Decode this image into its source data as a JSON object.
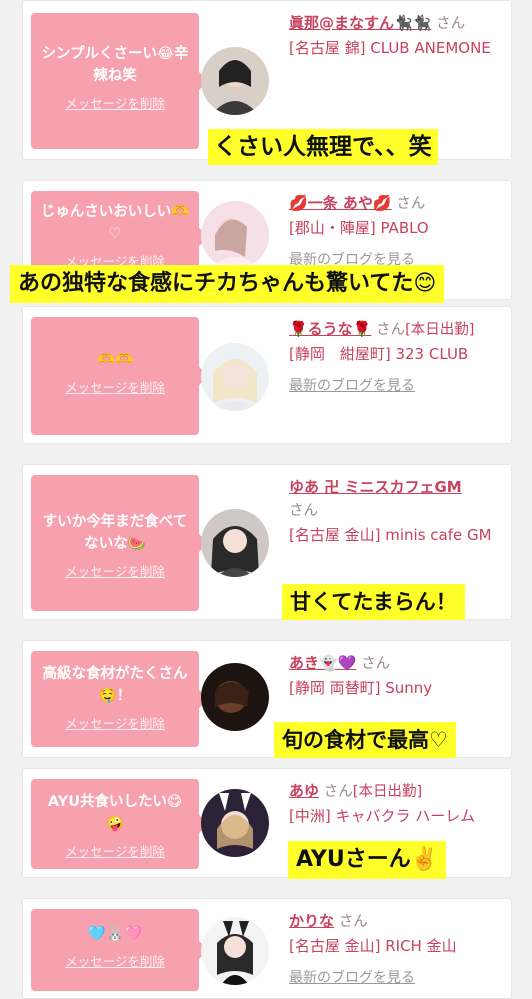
{
  "delete_label": "メッセージを削除",
  "blog_label": "最新のブログを見る",
  "san": "さん",
  "items": [
    {
      "message": "シンプルくさーい😂辛辣ね笑",
      "name": "眞那@まなすん🐈‍⬛🐈‍⬛",
      "status": "",
      "shop": "[名古屋 錦] CLUB ANEMONE",
      "caption": "くさい人無理で、、笑"
    },
    {
      "message": "じゅんさいおいしい🫶♡",
      "name": "💋一条 あや💋",
      "status": "",
      "shop": "[郡山・陣屋] PABLO",
      "blog": "最新のブログを見る",
      "caption": "あの独特な食感にチカちゃんも驚いてた😊"
    },
    {
      "message": "🫶🫶",
      "name": "🌹るうな🌹",
      "status": "[本日出勤]",
      "shop": "[静岡　紺屋町] 323 CLUB",
      "blog": "最新のブログを見る"
    },
    {
      "message": "すいか今年まだ食べてないな🍉",
      "name": "ゆあ 卍 ミニスカフェGM",
      "status": "",
      "shop": "[名古屋 金山] minis cafe GM",
      "caption": "甘くてたまらん！"
    },
    {
      "message": "高級な食材がたくさん🤤！",
      "name": "あき👻💜",
      "status": "",
      "shop": "[静岡 両替町] Sunny",
      "caption": "旬の食材で最高♡"
    },
    {
      "message": "AYU共食いしたい😋🤪",
      "name": "あゆ",
      "status": "[本日出勤]",
      "shop": "[中洲] キャバクラ ハーレム",
      "caption": "AYUさーん✌️"
    },
    {
      "message": "🩵🐰🩷",
      "name": "かりな",
      "status": "",
      "shop": "[名古屋 金山] RICH 金山",
      "blog": "最新のブログを見る"
    }
  ]
}
